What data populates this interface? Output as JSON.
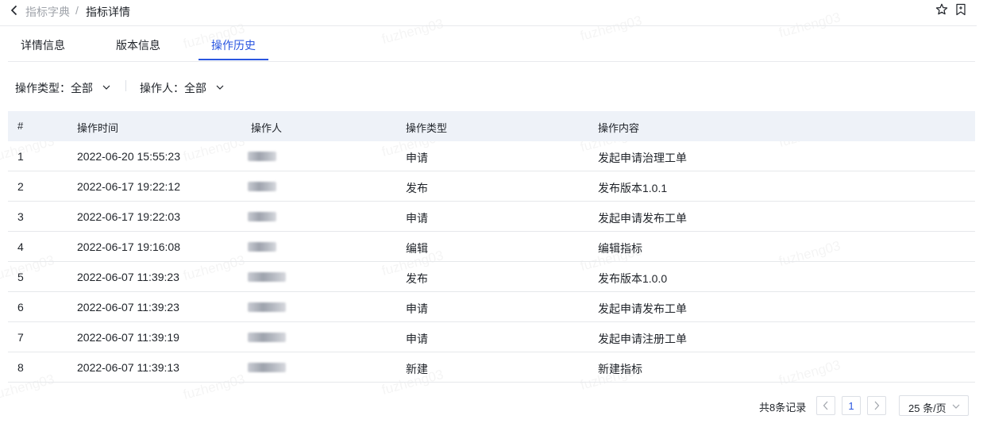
{
  "breadcrumb": {
    "root": "指标字典",
    "separator": "/",
    "current": "指标详情"
  },
  "tabs": [
    {
      "label": "详情信息",
      "active": false
    },
    {
      "label": "版本信息",
      "active": false
    },
    {
      "label": "操作历史",
      "active": true
    }
  ],
  "filters": {
    "type": {
      "label": "操作类型：",
      "value": "全部"
    },
    "operator": {
      "label": "操作人：",
      "value": "全部"
    }
  },
  "table": {
    "columns": [
      "#",
      "操作时间",
      "操作人",
      "操作类型",
      "操作内容"
    ],
    "rows": [
      {
        "index": "1",
        "time": "2022-06-20 15:55:23",
        "type": "申请",
        "content": "发起申请治理工单"
      },
      {
        "index": "2",
        "time": "2022-06-17 19:22:12",
        "type": "发布",
        "content": "发布版本1.0.1"
      },
      {
        "index": "3",
        "time": "2022-06-17 19:22:03",
        "type": "申请",
        "content": "发起申请发布工单"
      },
      {
        "index": "4",
        "time": "2022-06-17 19:16:08",
        "type": "编辑",
        "content": "编辑指标"
      },
      {
        "index": "5",
        "time": "2022-06-07 11:39:23",
        "type": "发布",
        "content": "发布版本1.0.0"
      },
      {
        "index": "6",
        "time": "2022-06-07 11:39:23",
        "type": "申请",
        "content": "发起申请发布工单"
      },
      {
        "index": "7",
        "time": "2022-06-07 11:39:19",
        "type": "申请",
        "content": "发起申请注册工单"
      },
      {
        "index": "8",
        "time": "2022-06-07 11:39:13",
        "type": "新建",
        "content": "新建指标"
      }
    ]
  },
  "pagination": {
    "total": "共8条记录",
    "current_page": "1",
    "page_size": "25 条/页"
  },
  "watermark": "fuzheng03",
  "colors": {
    "accent": "#2a56e0",
    "header_bg": "#eef2f8",
    "border": "#e6e8eb"
  },
  "icons": [
    "chevron-left-icon",
    "star-icon",
    "bookmark-icon",
    "chevron-down-icon",
    "chevron-right-icon"
  ]
}
